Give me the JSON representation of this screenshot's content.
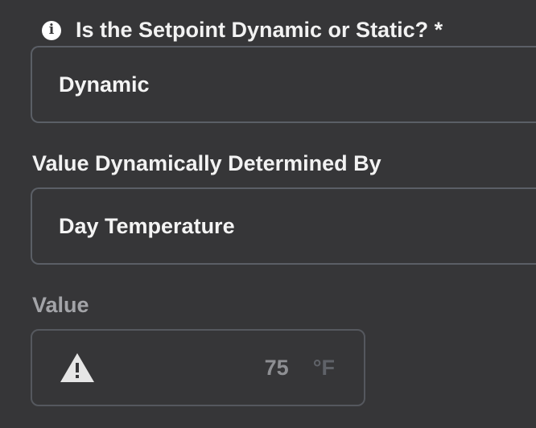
{
  "setpoint_type": {
    "label": "Is the Setpoint Dynamic or Static? *",
    "value": "Dynamic"
  },
  "dynamic_source": {
    "label": "Value Dynamically Determined By",
    "value": "Day Temperature"
  },
  "value_field": {
    "label": "Value",
    "value": "75",
    "unit": "°F"
  },
  "icons": {
    "info": "info-icon",
    "warning": "warning-triangle-icon"
  },
  "colors": {
    "background": "#363638",
    "field_border": "#5b5f66",
    "text": "#f2f2f2",
    "muted_text": "#a3a4a8"
  }
}
